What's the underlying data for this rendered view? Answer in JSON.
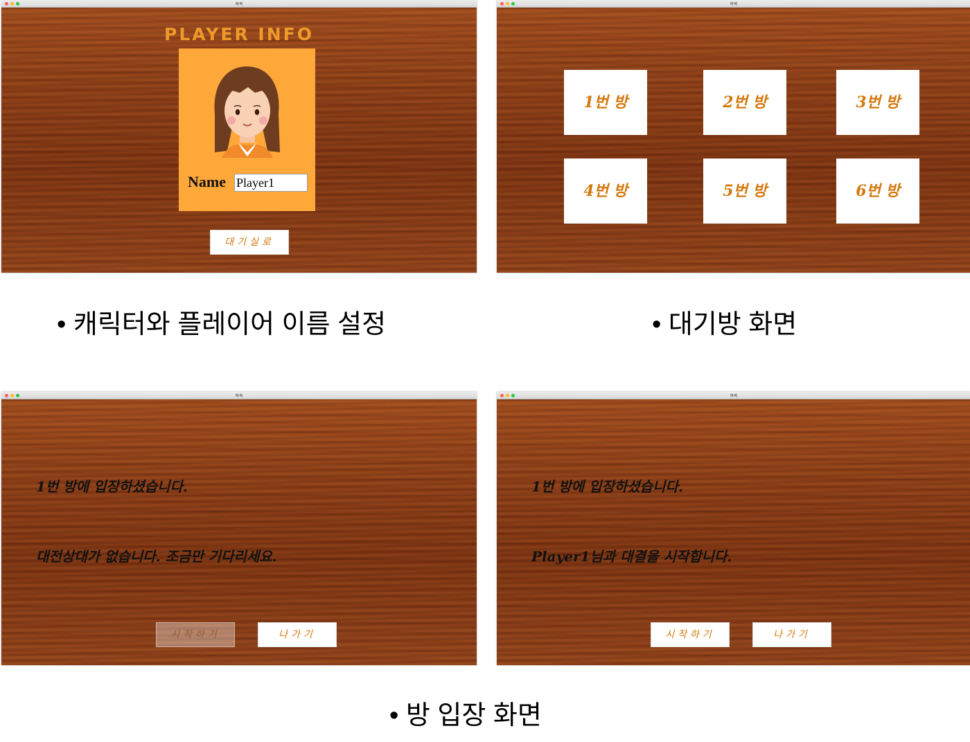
{
  "windows": [
    {
      "title": "목목"
    },
    {
      "title": "목목"
    },
    {
      "title": "목목"
    },
    {
      "title": "목목"
    }
  ],
  "player_info": {
    "heading": "PLAYER INFO",
    "name_label": "Name",
    "name_value": "Player1",
    "waiting_room_button": "대기실로"
  },
  "lobby": {
    "rooms": [
      "1번 방",
      "2번 방",
      "3번 방",
      "4번 방",
      "5번 방",
      "6번 방"
    ]
  },
  "room_waiting": {
    "entered_msg": "1번 방에 입장하셨습니다.",
    "status_msg": "대전상대가 없습니다. 조금만 기다리세요.",
    "start_button": "시작하기",
    "exit_button": "나가기"
  },
  "room_ready": {
    "entered_msg": "1번 방에 입장하셨습니다.",
    "status_msg": "Player1님과 대결을 시작합니다.",
    "start_button": "시작하기",
    "exit_button": "나가기"
  },
  "captions": {
    "character_setup": "• 캐릭터와 플레이어 이름 설정",
    "lobby": "• 대기방 화면",
    "room_entry": "• 방 입장 화면"
  },
  "colors": {
    "accent_orange": "#d4780c",
    "card_orange": "#ffa83a",
    "wood_base": "#8a3c15"
  }
}
